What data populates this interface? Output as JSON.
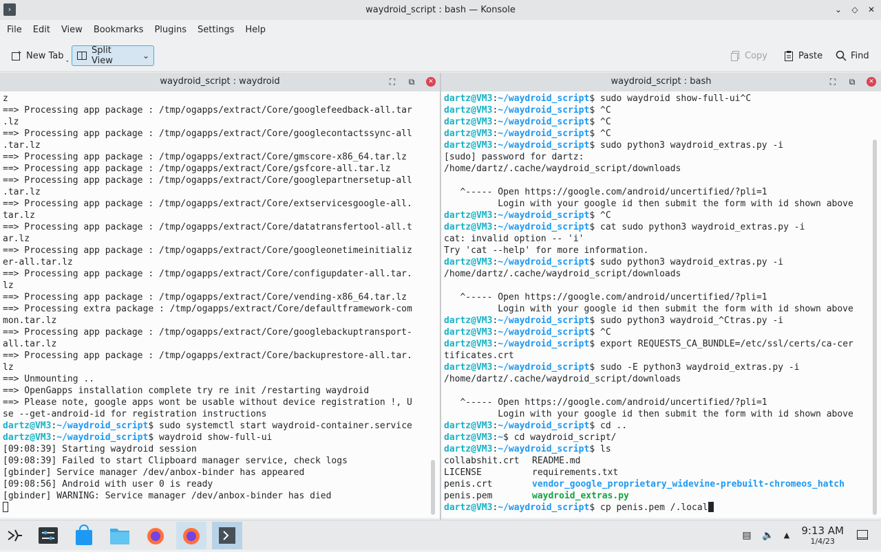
{
  "window": {
    "title": "waydroid_script : bash — Konsole"
  },
  "menu": [
    "File",
    "Edit",
    "View",
    "Bookmarks",
    "Plugins",
    "Settings",
    "Help"
  ],
  "toolbar": {
    "new_tab": "New Tab",
    "split_view": "Split View",
    "copy": "Copy",
    "paste": "Paste",
    "find": "Find"
  },
  "left_pane": {
    "title": "waydroid_script : waydroid",
    "lines": [
      {
        "t": "z"
      },
      {
        "t": "==> Processing app package : /tmp/ogapps/extract/Core/googlefeedback-all.tar"
      },
      {
        "t": ".lz"
      },
      {
        "t": "==> Processing app package : /tmp/ogapps/extract/Core/googlecontactssync-all"
      },
      {
        "t": ".tar.lz"
      },
      {
        "t": "==> Processing app package : /tmp/ogapps/extract/Core/gmscore-x86_64.tar.lz"
      },
      {
        "t": "==> Processing app package : /tmp/ogapps/extract/Core/gsfcore-all.tar.lz"
      },
      {
        "t": "==> Processing app package : /tmp/ogapps/extract/Core/googlepartnersetup-all"
      },
      {
        "t": ".tar.lz"
      },
      {
        "t": "==> Processing app package : /tmp/ogapps/extract/Core/extservicesgoogle-all."
      },
      {
        "t": "tar.lz"
      },
      {
        "t": "==> Processing app package : /tmp/ogapps/extract/Core/datatransfertool-all.t"
      },
      {
        "t": "ar.lz"
      },
      {
        "t": "==> Processing app package : /tmp/ogapps/extract/Core/googleonetimeinitializ"
      },
      {
        "t": "er-all.tar.lz"
      },
      {
        "t": "==> Processing app package : /tmp/ogapps/extract/Core/configupdater-all.tar."
      },
      {
        "t": "lz"
      },
      {
        "t": "==> Processing app package : /tmp/ogapps/extract/Core/vending-x86_64.tar.lz"
      },
      {
        "t": "==> Processing extra package : /tmp/ogapps/extract/Core/defaultframework-com"
      },
      {
        "t": "mon.tar.lz"
      },
      {
        "t": "==> Processing app package : /tmp/ogapps/extract/Core/googlebackuptransport-"
      },
      {
        "t": "all.tar.lz"
      },
      {
        "t": "==> Processing app package : /tmp/ogapps/extract/Core/backuprestore-all.tar."
      },
      {
        "t": "lz"
      },
      {
        "t": "==> Unmounting .."
      },
      {
        "t": "==> OpenGapps installation complete try re init /restarting waydroid"
      },
      {
        "t": "==> Please note, google apps wont be usable without device registration !, U"
      },
      {
        "t": "se --get-android-id for registration instructions"
      },
      {
        "user": "dartz@VM3",
        "path": "~/waydroid_script",
        "cmd": "$ sudo systemctl start waydroid-container.service"
      },
      {
        "user": "dartz@VM3",
        "path": "~/waydroid_script",
        "cmd": "$ waydroid show-full-ui"
      },
      {
        "t": "[09:08:39] Starting waydroid session"
      },
      {
        "t": "[09:08:39] Failed to start Clipboard manager service, check logs"
      },
      {
        "t": "[gbinder] Service manager /dev/anbox-binder has appeared"
      },
      {
        "t": "[09:08:56] Android with user 0 is ready"
      },
      {
        "t": "[gbinder] WARNING: Service manager /dev/anbox-binder has died"
      },
      {
        "cursor": "empty"
      }
    ]
  },
  "right_pane": {
    "title": "waydroid_script : bash",
    "lines": [
      {
        "user": "dartz@VM3",
        "path": "~/waydroid_script",
        "cmd": "$ sudo waydroid show-full-ui^C"
      },
      {
        "user": "dartz@VM3",
        "path": "~/waydroid_script",
        "cmd": "$ ^C"
      },
      {
        "user": "dartz@VM3",
        "path": "~/waydroid_script",
        "cmd": "$ ^C"
      },
      {
        "user": "dartz@VM3",
        "path": "~/waydroid_script",
        "cmd": "$ ^C"
      },
      {
        "user": "dartz@VM3",
        "path": "~/waydroid_script",
        "cmd": "$ sudo python3 waydroid_extras.py -i"
      },
      {
        "t": "[sudo] password for dartz:"
      },
      {
        "t": "/home/dartz/.cache/waydroid_script/downloads"
      },
      {
        "t": ""
      },
      {
        "t": "   ^----- Open https://google.com/android/uncertified/?pli=1"
      },
      {
        "t": "          Login with your google id then submit the form with id shown above"
      },
      {
        "user": "dartz@VM3",
        "path": "~/waydroid_script",
        "cmd": "$ ^C"
      },
      {
        "user": "dartz@VM3",
        "path": "~/waydroid_script",
        "cmd": "$ cat sudo python3 waydroid_extras.py -i"
      },
      {
        "t": "cat: invalid option -- 'i'"
      },
      {
        "t": "Try 'cat --help' for more information."
      },
      {
        "user": "dartz@VM3",
        "path": "~/waydroid_script",
        "cmd": "$ sudo python3 waydroid_extras.py -i"
      },
      {
        "t": "/home/dartz/.cache/waydroid_script/downloads"
      },
      {
        "t": ""
      },
      {
        "t": "   ^----- Open https://google.com/android/uncertified/?pli=1"
      },
      {
        "t": "          Login with your google id then submit the form with id shown above"
      },
      {
        "user": "dartz@VM3",
        "path": "~/waydroid_script",
        "cmd": "$ sudo python3 waydroid_^Ctras.py -i"
      },
      {
        "user": "dartz@VM3",
        "path": "~/waydroid_script",
        "cmd": "$ ^C"
      },
      {
        "user": "dartz@VM3",
        "path": "~/waydroid_script",
        "cmd": "$ export REQUESTS_CA_BUNDLE=/etc/ssl/certs/ca-cer"
      },
      {
        "t": "tificates.crt"
      },
      {
        "user": "dartz@VM3",
        "path": "~/waydroid_script",
        "cmd": "$ sudo -E python3 waydroid_extras.py -i"
      },
      {
        "t": "/home/dartz/.cache/waydroid_script/downloads"
      },
      {
        "t": ""
      },
      {
        "t": "   ^----- Open https://google.com/android/uncertified/?pli=1"
      },
      {
        "t": "          Login with your google id then submit the form with id shown above"
      },
      {
        "user": "dartz@VM3",
        "path": "~/waydroid_script",
        "cmd": "$ cd .."
      },
      {
        "user": "dartz@VM3",
        "path": "~",
        "cmd": "$ cd waydroid_script/"
      },
      {
        "user": "dartz@VM3",
        "path": "~/waydroid_script",
        "cmd": "$ ls"
      },
      {
        "ls": [
          "collabshit.crt",
          "README.md"
        ]
      },
      {
        "ls": [
          "LICENSE",
          "requirements.txt"
        ]
      },
      {
        "ls": [
          "penis.crt",
          "vendor_google_proprietary_widevine-prebuilt-chromeos_hatch"
        ],
        "cls2": "lsdir"
      },
      {
        "ls": [
          "penis.pem",
          "waydroid_extras.py"
        ],
        "cls2": "lsexe"
      },
      {
        "user": "dartz@VM3",
        "path": "~/waydroid_script",
        "cmd": "$ cp penis.pem /.local",
        "cursor": "full"
      }
    ]
  },
  "taskbar": {
    "time": "9:13 AM",
    "date": "1/4/23"
  },
  "colors": {
    "prompt_user": "#18b2c7",
    "prompt_path": "#1d99f3",
    "accent": "#3daee9"
  }
}
